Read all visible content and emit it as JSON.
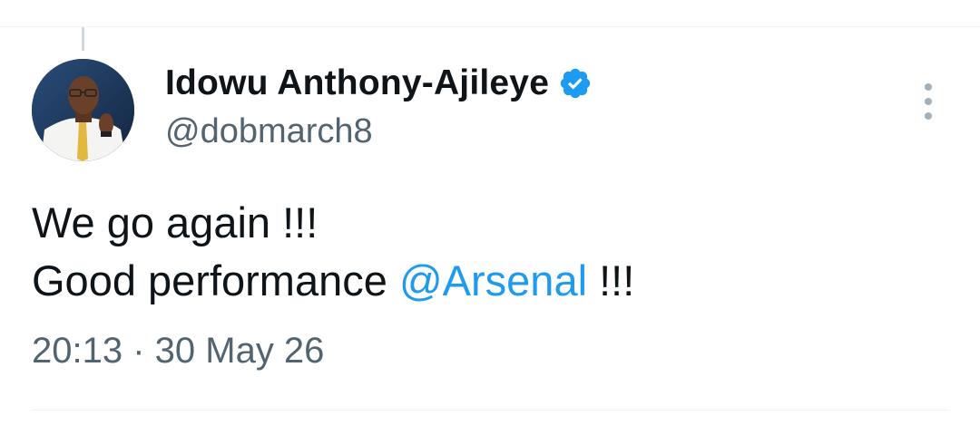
{
  "tweet": {
    "author": {
      "display_name": "Idowu Anthony-Ajileye",
      "handle": "@dobmarch8",
      "verified": true,
      "verified_icon": "verified-badge-icon",
      "verified_color": "#1d9bf0"
    },
    "body": {
      "line1": "We go again !!!",
      "line2_prefix": "Good performance ",
      "mention": "@Arsenal",
      "line2_suffix": " !!!"
    },
    "timestamp": "20:13 · 30 May 26",
    "more_icon": "more-vertical-icon"
  },
  "colors": {
    "text_primary": "#0f1419",
    "text_secondary": "#536471",
    "link": "#1d9bf0",
    "divider": "#eff3f4"
  }
}
